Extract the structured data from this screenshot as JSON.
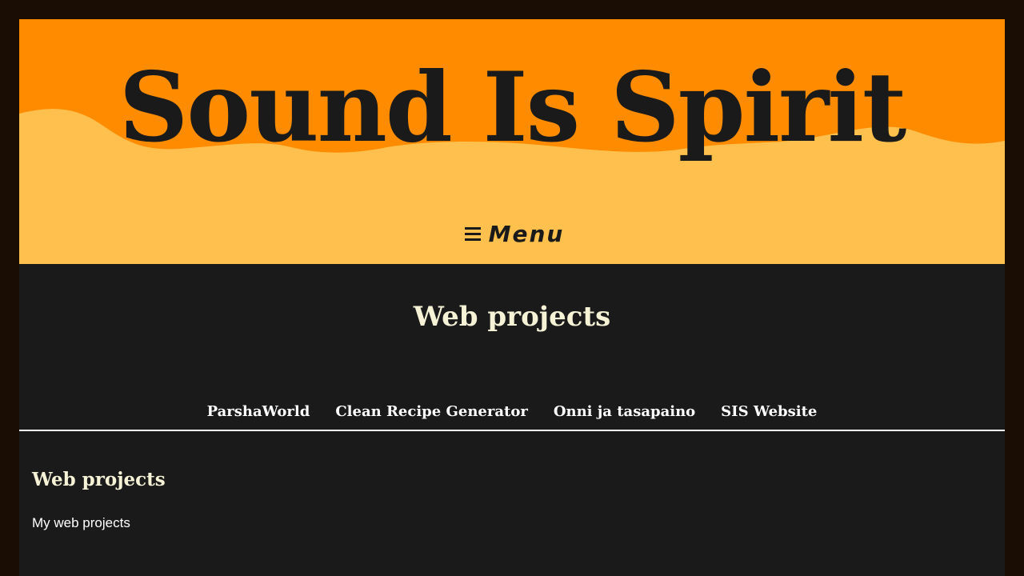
{
  "header": {
    "site_title": "Sound Is Spirit",
    "menu_label": "Menu",
    "menu_icon": "hamburger-icon"
  },
  "projects": {
    "title": "Web projects",
    "links": [
      {
        "label": "ParshaWorld"
      },
      {
        "label": "Clean Recipe Generator"
      },
      {
        "label": "Onni ja tasapaino"
      },
      {
        "label": "SIS Website"
      }
    ]
  },
  "content": {
    "heading": "Web projects",
    "description": "My web projects"
  },
  "colors": {
    "page_background": "#1a0d04",
    "header_orange": "#ff8c00",
    "header_wave": "#ffc04d",
    "content_background": "#1a1a1a",
    "heading_cream": "#f6f2d6"
  }
}
